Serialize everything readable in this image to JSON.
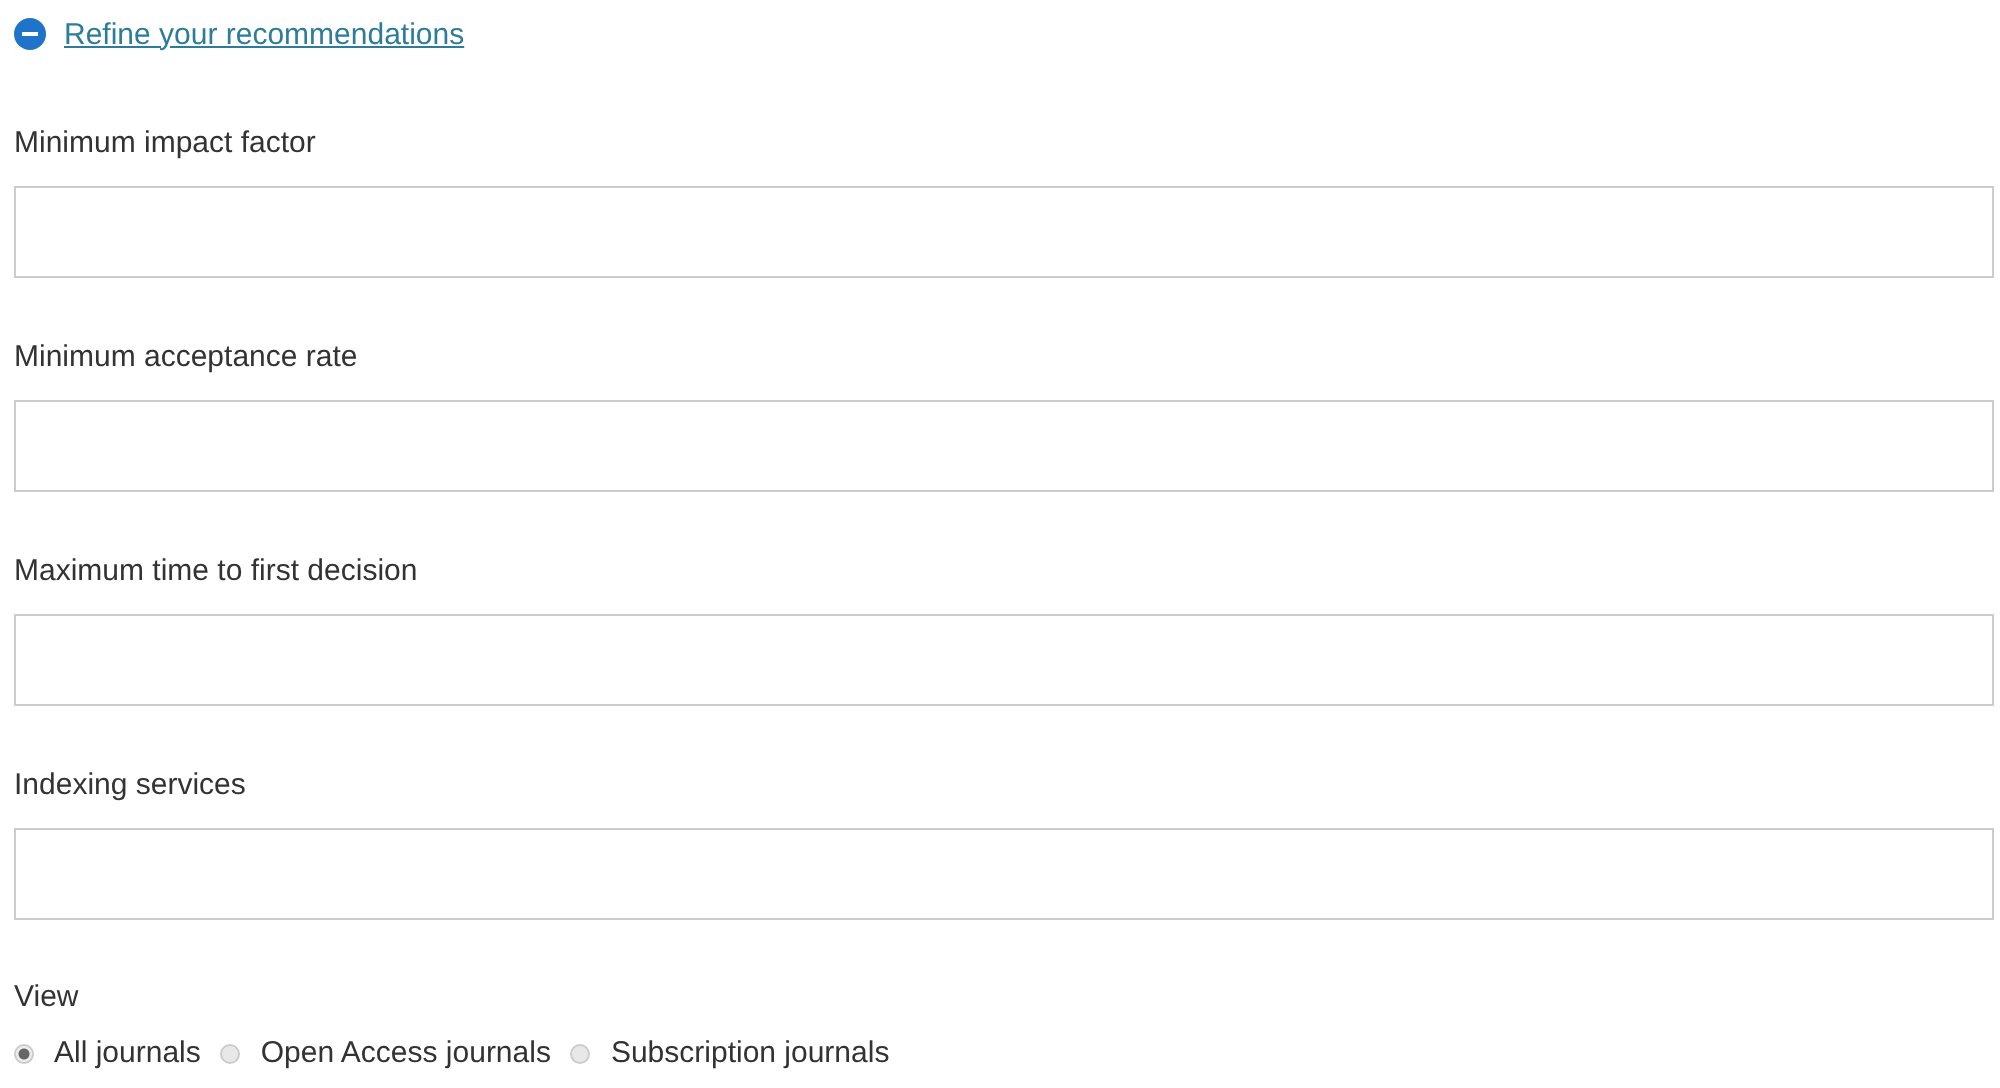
{
  "toggle": {
    "label": "Refine your recommendations",
    "expanded": true
  },
  "fields": [
    {
      "label": "Minimum impact factor"
    },
    {
      "label": "Minimum acceptance rate"
    },
    {
      "label": "Maximum time to first decision"
    },
    {
      "label": "Indexing services"
    }
  ],
  "view": {
    "label": "View",
    "options": [
      {
        "label": "All journals",
        "selected": true
      },
      {
        "label": "Open Access journals",
        "selected": false
      },
      {
        "label": "Subscription journals",
        "selected": false
      }
    ]
  }
}
